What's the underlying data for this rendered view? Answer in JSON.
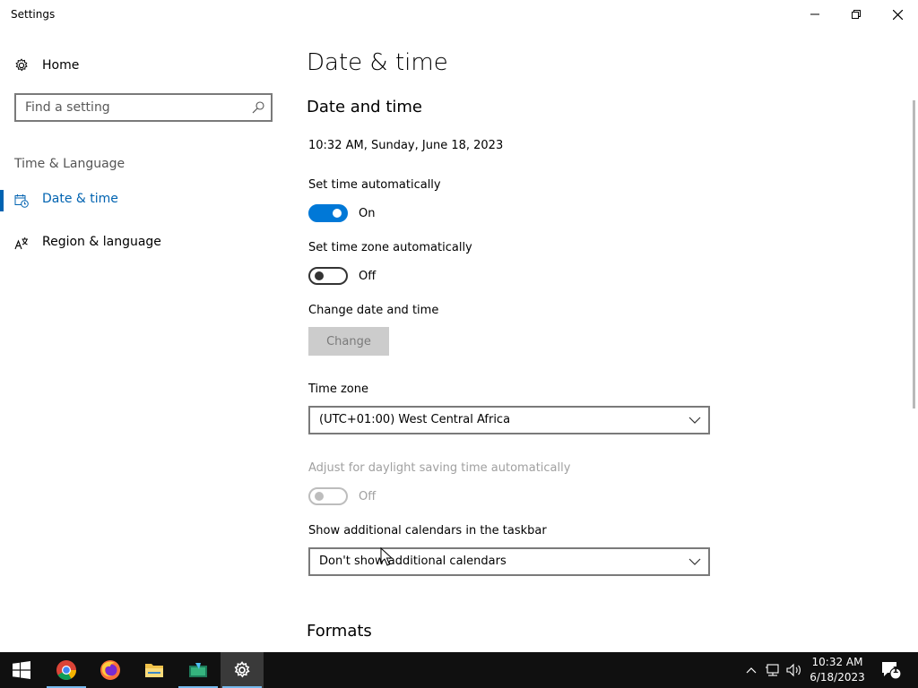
{
  "window": {
    "title": "Settings"
  },
  "sidebar": {
    "home_label": "Home",
    "search_placeholder": "Find a setting",
    "section_label": "Time & Language",
    "items": [
      {
        "label": "Date & time",
        "active": true,
        "icon": "calendar-clock-icon"
      },
      {
        "label": "Region & language",
        "active": false,
        "icon": "language-icon"
      }
    ]
  },
  "main": {
    "page_title": "Date & time",
    "section_title": "Date and time",
    "current_datetime": "10:32 AM, Sunday, June 18, 2023",
    "set_time_auto": {
      "label": "Set time automatically",
      "state": "On",
      "on": true
    },
    "set_tz_auto": {
      "label": "Set time zone automatically",
      "state": "Off",
      "on": false
    },
    "change_dt": {
      "label": "Change date and time",
      "button": "Change",
      "enabled": false
    },
    "time_zone": {
      "label": "Time zone",
      "value": "(UTC+01:00) West Central Africa"
    },
    "dst": {
      "label": "Adjust for daylight saving time automatically",
      "state": "Off",
      "enabled": false
    },
    "calendars": {
      "label": "Show additional calendars in the taskbar",
      "value": "Don't show additional calendars"
    },
    "formats_title": "Formats"
  },
  "taskbar": {
    "apps": [
      "start-icon",
      "chrome-icon",
      "firefox-icon",
      "file-explorer-icon",
      "app-icon",
      "settings-icon"
    ],
    "time": "10:32 AM",
    "date": "6/18/2023",
    "notification_count": "1"
  },
  "colors": {
    "accent": "#0078d7",
    "taskbar": "#101010"
  }
}
